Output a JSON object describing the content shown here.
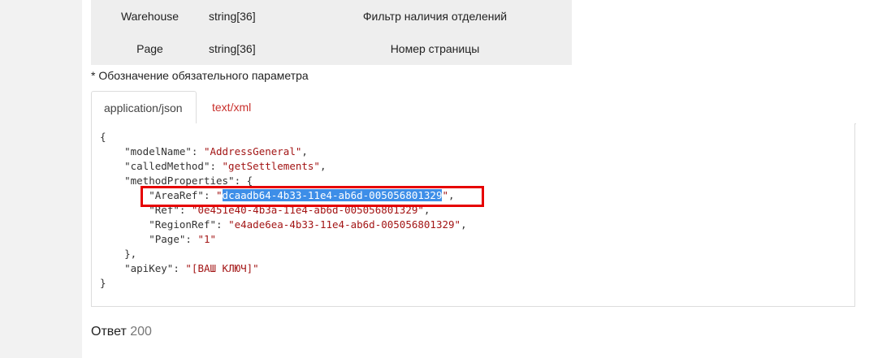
{
  "params_table": {
    "rows": [
      {
        "name": "Warehouse",
        "type": "string[36]",
        "description": "Фильтр наличия отделений"
      },
      {
        "name": "Page",
        "type": "string[36]",
        "description": "Номер страницы"
      }
    ]
  },
  "required_note": "* Обозначение обязательного параметра",
  "tabs": [
    {
      "label": "application/json",
      "active": true
    },
    {
      "label": "text/xml",
      "active": false
    }
  ],
  "code": {
    "open_brace": "{",
    "model_name_key": "\"modelName\"",
    "model_name_value": "\"AddressGeneral\"",
    "called_method_key": "\"calledMethod\"",
    "called_method_value": "\"getSettlements\"",
    "method_properties_key": "\"methodProperties\"",
    "area_ref_key": "\"AreaRef\"",
    "area_ref_value": "dcaadb64-4b33-11e4-ab6d-005056801329",
    "ref_key": "\"Ref\"",
    "ref_value": "\"0e451e40-4b3a-11e4-ab6d-005056801329\"",
    "region_ref_key": "\"RegionRef\"",
    "region_ref_value": "\"e4ade6ea-4b33-11e4-ab6d-005056801329\"",
    "page_key": "\"Page\"",
    "page_value": "\"1\"",
    "api_key_key": "\"apiKey\"",
    "api_key_value": "\"[ВАШ КЛЮЧ]\"",
    "close_brace": "}"
  },
  "response": {
    "label": "Ответ",
    "status": "200"
  },
  "colors": {
    "string": "#a31515",
    "selection": "#3d8ee8",
    "highlight_border": "#e60000",
    "inactive_tab": "#c9302c"
  }
}
